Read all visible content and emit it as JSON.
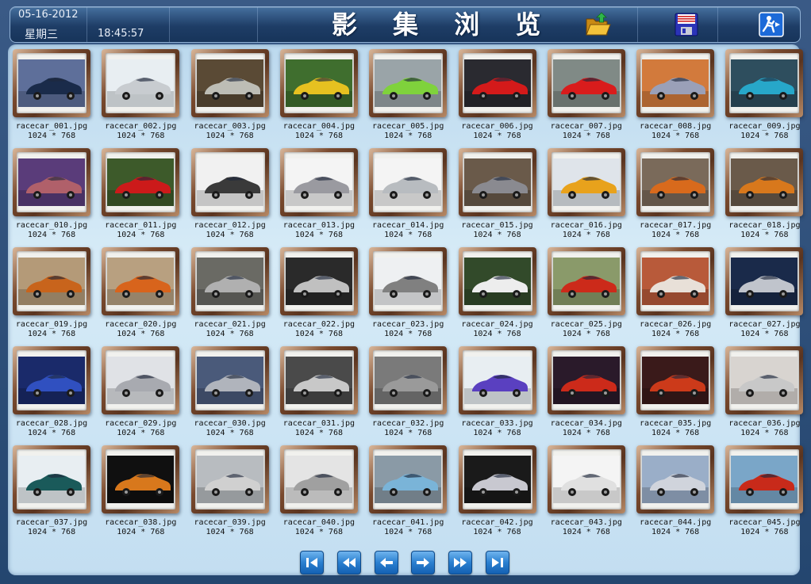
{
  "header": {
    "date": "05-16-2012",
    "weekday": "星期三",
    "time": "18:45:57",
    "title": "影 集 浏 览",
    "buttons": [
      {
        "name": "open-folder-icon"
      },
      {
        "name": "save-disk-icon"
      },
      {
        "name": "exit-icon"
      }
    ]
  },
  "gallery": {
    "items": [
      {
        "file": "racecar_001.jpg",
        "size": "1024 * 768",
        "bg": "#5e6f9a",
        "car": "#1a2b4a"
      },
      {
        "file": "racecar_002.jpg",
        "size": "1024 * 768",
        "bg": "#e8eef2",
        "car": "#c8ccd0"
      },
      {
        "file": "racecar_003.jpg",
        "size": "1024 * 768",
        "bg": "#5a4a35",
        "car": "#bdbdb5"
      },
      {
        "file": "racecar_004.jpg",
        "size": "1024 * 768",
        "bg": "#3f6e2e",
        "car": "#e6c120"
      },
      {
        "file": "racecar_005.jpg",
        "size": "1024 * 768",
        "bg": "#9aa4a8",
        "car": "#7fd23c"
      },
      {
        "file": "racecar_006.jpg",
        "size": "1024 * 768",
        "bg": "#2a2a30",
        "car": "#d41a1a"
      },
      {
        "file": "racecar_007.jpg",
        "size": "1024 * 768",
        "bg": "#808a86",
        "car": "#d91c1c"
      },
      {
        "file": "racecar_008.jpg",
        "size": "1024 * 768",
        "bg": "#d27a3c",
        "car": "#9aa0b8"
      },
      {
        "file": "racecar_009.jpg",
        "size": "1024 * 768",
        "bg": "#2e4e5e",
        "car": "#27a7c9"
      },
      {
        "file": "racecar_010.jpg",
        "size": "1024 * 768",
        "bg": "#5a3c7a",
        "car": "#b0606a"
      },
      {
        "file": "racecar_011.jpg",
        "size": "1024 * 768",
        "bg": "#3d5a2a",
        "car": "#cc1a1a"
      },
      {
        "file": "racecar_012.jpg",
        "size": "1024 * 768",
        "bg": "#f1f1f1",
        "car": "#3a3a3a"
      },
      {
        "file": "racecar_013.jpg",
        "size": "1024 * 768",
        "bg": "#f4f4f4",
        "car": "#9a9aa0"
      },
      {
        "file": "racecar_014.jpg",
        "size": "1024 * 768",
        "bg": "#f4f4f4",
        "car": "#b8bcc0"
      },
      {
        "file": "racecar_015.jpg",
        "size": "1024 * 768",
        "bg": "#6a5a4a",
        "car": "#8a8a90"
      },
      {
        "file": "racecar_016.jpg",
        "size": "1024 * 768",
        "bg": "#dfe4ea",
        "car": "#e8a21c"
      },
      {
        "file": "racecar_017.jpg",
        "size": "1024 * 768",
        "bg": "#7a6a5a",
        "car": "#d86a1c"
      },
      {
        "file": "racecar_018.jpg",
        "size": "1024 * 768",
        "bg": "#6a5a4a",
        "car": "#d8781c"
      },
      {
        "file": "racecar_019.jpg",
        "size": "1024 * 768",
        "bg": "#b49a78",
        "car": "#c8641c"
      },
      {
        "file": "racecar_020.jpg",
        "size": "1024 * 768",
        "bg": "#b8a080",
        "car": "#d8641c"
      },
      {
        "file": "racecar_021.jpg",
        "size": "1024 * 768",
        "bg": "#6a6a64",
        "car": "#b0b0b0"
      },
      {
        "file": "racecar_022.jpg",
        "size": "1024 * 768",
        "bg": "#2a2a2a",
        "car": "#c0c0c0"
      },
      {
        "file": "racecar_023.jpg",
        "size": "1024 * 768",
        "bg": "#eef0f2",
        "car": "#808080"
      },
      {
        "file": "racecar_024.jpg",
        "size": "1024 * 768",
        "bg": "#324a2a",
        "car": "#ededed"
      },
      {
        "file": "racecar_025.jpg",
        "size": "1024 * 768",
        "bg": "#8a9a6a",
        "car": "#cc2a1a"
      },
      {
        "file": "racecar_026.jpg",
        "size": "1024 * 768",
        "bg": "#b85a3a",
        "car": "#e8e0d8"
      },
      {
        "file": "racecar_027.jpg",
        "size": "1024 * 768",
        "bg": "#1a2a4a",
        "car": "#c0c4cc"
      },
      {
        "file": "racecar_028.jpg",
        "size": "1024 * 768",
        "bg": "#1a2a6a",
        "car": "#3050c0"
      },
      {
        "file": "racecar_029.jpg",
        "size": "1024 * 768",
        "bg": "#e0e2e6",
        "car": "#a8aab0"
      },
      {
        "file": "racecar_030.jpg",
        "size": "1024 * 768",
        "bg": "#4a5a7a",
        "car": "#b0b4bc"
      },
      {
        "file": "racecar_031.jpg",
        "size": "1024 * 768",
        "bg": "#4a4a4a",
        "car": "#c8c8c8"
      },
      {
        "file": "racecar_032.jpg",
        "size": "1024 * 768",
        "bg": "#7a7a7a",
        "car": "#9a9a9a"
      },
      {
        "file": "racecar_033.jpg",
        "size": "1024 * 768",
        "bg": "#e8eef2",
        "car": "#5a40c0"
      },
      {
        "file": "racecar_034.jpg",
        "size": "1024 * 768",
        "bg": "#2a1a2a",
        "car": "#cc2a1a"
      },
      {
        "file": "racecar_035.jpg",
        "size": "1024 * 768",
        "bg": "#3a1a1a",
        "car": "#cc3a1a"
      },
      {
        "file": "racecar_036.jpg",
        "size": "1024 * 768",
        "bg": "#d8d4d0",
        "car": "#c8c8c8"
      },
      {
        "file": "racecar_037.jpg",
        "size": "1024 * 768",
        "bg": "#e8eef2",
        "car": "#1a5a5a"
      },
      {
        "file": "racecar_038.jpg",
        "size": "1024 * 768",
        "bg": "#101010",
        "car": "#d8781c"
      },
      {
        "file": "racecar_039.jpg",
        "size": "1024 * 768",
        "bg": "#b8bcc0",
        "car": "#d0d0d0"
      },
      {
        "file": "racecar_040.jpg",
        "size": "1024 * 768",
        "bg": "#e4e4e4",
        "car": "#a0a0a0"
      },
      {
        "file": "racecar_041.jpg",
        "size": "1024 * 768",
        "bg": "#8a9aa6",
        "car": "#7ab4d8"
      },
      {
        "file": "racecar_042.jpg",
        "size": "1024 * 768",
        "bg": "#1a1a1a",
        "car": "#c8c8d0"
      },
      {
        "file": "racecar_043.jpg",
        "size": "1024 * 768",
        "bg": "#f4f4f4",
        "car": "#e0e0e0"
      },
      {
        "file": "racecar_044.jpg",
        "size": "1024 * 768",
        "bg": "#9aaec8",
        "car": "#d0d4dc"
      },
      {
        "file": "racecar_045.jpg",
        "size": "1024 * 768",
        "bg": "#7aa6c8",
        "car": "#c82a1a"
      }
    ]
  },
  "pager": {
    "buttons": [
      {
        "name": "first-page-button",
        "icon": "first-page-icon"
      },
      {
        "name": "previous-block-button",
        "icon": "rewind-icon"
      },
      {
        "name": "previous-page-button",
        "icon": "arrow-left-icon"
      },
      {
        "name": "next-page-button",
        "icon": "arrow-right-icon"
      },
      {
        "name": "next-block-button",
        "icon": "fast-forward-icon"
      },
      {
        "name": "last-page-button",
        "icon": "last-page-icon"
      }
    ]
  },
  "colors": {
    "header_bg": "#1e3d66",
    "panel_bg": "#c9e2f3",
    "frame_wood": "#7a4a2e",
    "pager_blue": "#2a7fd0"
  }
}
